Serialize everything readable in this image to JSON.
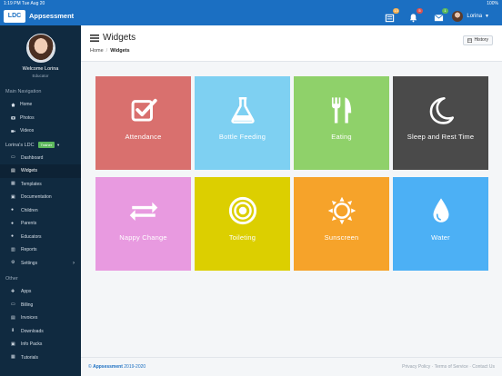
{
  "status_bar": {
    "time_date": "1:19 PM   Tue Aug 20",
    "battery": "100%"
  },
  "header": {
    "logo_text": "LDC",
    "brand": "Appsessment",
    "badges": {
      "tasks": "13",
      "notifications": "5",
      "messages": "1"
    },
    "user_name": "Lorina"
  },
  "sidebar": {
    "welcome": "Welcome Lorina",
    "role": "Educator",
    "main_nav_title": "Main Navigation",
    "main_nav": [
      {
        "label": "Home",
        "icon": "home-icon"
      },
      {
        "label": "Photos",
        "icon": "camera-icon"
      },
      {
        "label": "Videos",
        "icon": "video-icon"
      }
    ],
    "ldc_label": "Lorina's LDC",
    "ldc_pill": "Trainer",
    "ldc_nav": [
      {
        "label": "Dashboard",
        "icon": "dashboard-icon"
      },
      {
        "label": "Widgets",
        "icon": "widgets-icon",
        "active": true
      },
      {
        "label": "Templates",
        "icon": "templates-icon"
      },
      {
        "label": "Documentation",
        "icon": "documentation-icon"
      },
      {
        "label": "Children",
        "icon": "children-icon"
      },
      {
        "label": "Parents",
        "icon": "parents-icon"
      },
      {
        "label": "Educators",
        "icon": "educators-icon"
      },
      {
        "label": "Reports",
        "icon": "reports-icon"
      },
      {
        "label": "Settings",
        "icon": "settings-icon"
      }
    ],
    "other_title": "Other",
    "other_nav": [
      {
        "label": "Apps",
        "icon": "apps-icon"
      },
      {
        "label": "Billing",
        "icon": "billing-icon"
      },
      {
        "label": "Invoices",
        "icon": "invoices-icon"
      },
      {
        "label": "Downloads",
        "icon": "download-icon"
      },
      {
        "label": "Info Packs",
        "icon": "info-packs-icon"
      },
      {
        "label": "Tutorials",
        "icon": "tutorials-icon"
      }
    ]
  },
  "page": {
    "title": "Widgets",
    "breadcrumb_home": "Home",
    "breadcrumb_current": "Widgets",
    "history_label": "History"
  },
  "widgets": [
    {
      "label": "Attendance",
      "icon": "checkbox-icon",
      "color": "#d9706e"
    },
    {
      "label": "Bottle Feeding",
      "icon": "flask-icon",
      "color": "#7ed0f2"
    },
    {
      "label": "Eating",
      "icon": "cutlery-icon",
      "color": "#8fd16a"
    },
    {
      "label": "Sleep and Rest Time",
      "icon": "moon-icon",
      "color": "#4a4a4a"
    },
    {
      "label": "Nappy Change",
      "icon": "exchange-icon",
      "color": "#e89ae0"
    },
    {
      "label": "Toileting",
      "icon": "target-icon",
      "color": "#dccf00"
    },
    {
      "label": "Sunscreen",
      "icon": "sun-icon",
      "color": "#f6a32a"
    },
    {
      "label": "Water",
      "icon": "drop-icon",
      "color": "#4cb0f5"
    }
  ],
  "footer": {
    "brand": "Appsessment",
    "years": "2019-2020",
    "links": "Privacy Policy · Terms of Service · Contact Us"
  }
}
